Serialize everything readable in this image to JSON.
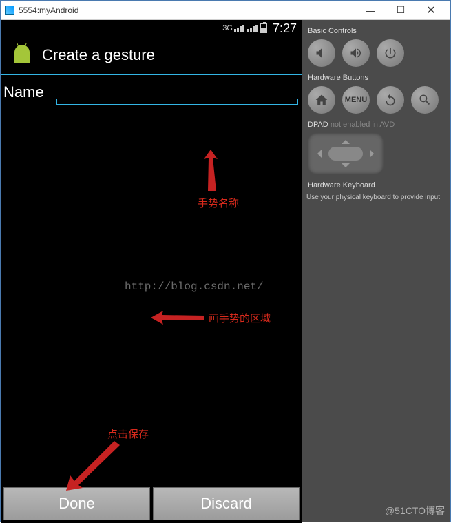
{
  "window": {
    "title": "5554:myAndroid",
    "minimize": "—",
    "maximize": "☐",
    "close": "✕"
  },
  "statusbar": {
    "signal_prefix": "3G",
    "time": "7:27"
  },
  "appbar": {
    "title": "Create a gesture"
  },
  "form": {
    "name_label": "Name"
  },
  "buttons": {
    "done": "Done",
    "discard": "Discard"
  },
  "annotations": {
    "name_hint": "手势名称",
    "draw_hint": "画手势的区域",
    "save_hint": "点击保存"
  },
  "watermark": {
    "url": "http://blog.csdn.net/",
    "credit": "@51CTO博客"
  },
  "sidepanel": {
    "basic_title": "Basic Controls",
    "hw_title": "Hardware Buttons",
    "menu_label": "MENU",
    "dpad_title": "DPAD",
    "dpad_note": "not enabled in AVD",
    "kb_title": "Hardware Keyboard",
    "kb_note": "Use your physical keyboard to provide input"
  }
}
